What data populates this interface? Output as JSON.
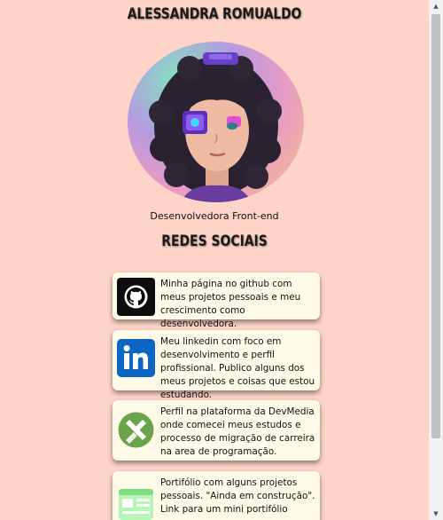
{
  "profile": {
    "name": "ALESSANDRA ROMUALDO",
    "role": "Desenvolvedora Front-end"
  },
  "social": {
    "title": "REDES SOCIAIS",
    "cards": [
      {
        "icon": "github-icon",
        "text": "Minha página no github com meus projetos pessoais e meu crescimento como desenvolvedora."
      },
      {
        "icon": "linkedin-icon",
        "text": "Meu linkedin com foco em desenvolvimento e perfil profissional. Publico alguns dos meus projetos e coisas que estou estudando."
      },
      {
        "icon": "devmedia-icon",
        "text": "Perfil na plataforma da DevMedia onde comecei meus estudos e processo de migração de carreira na area de programação."
      },
      {
        "icon": "portfolio-icon",
        "text": "Portifólio com alguns projetos pessoais. \"Ainda em construção\". Link para um mini portifólio"
      }
    ]
  },
  "colors": {
    "background": "#ffd4c8",
    "card": "#fffbe8",
    "linkedin": "#0a66c2",
    "devmedia": "#6ba34a"
  }
}
